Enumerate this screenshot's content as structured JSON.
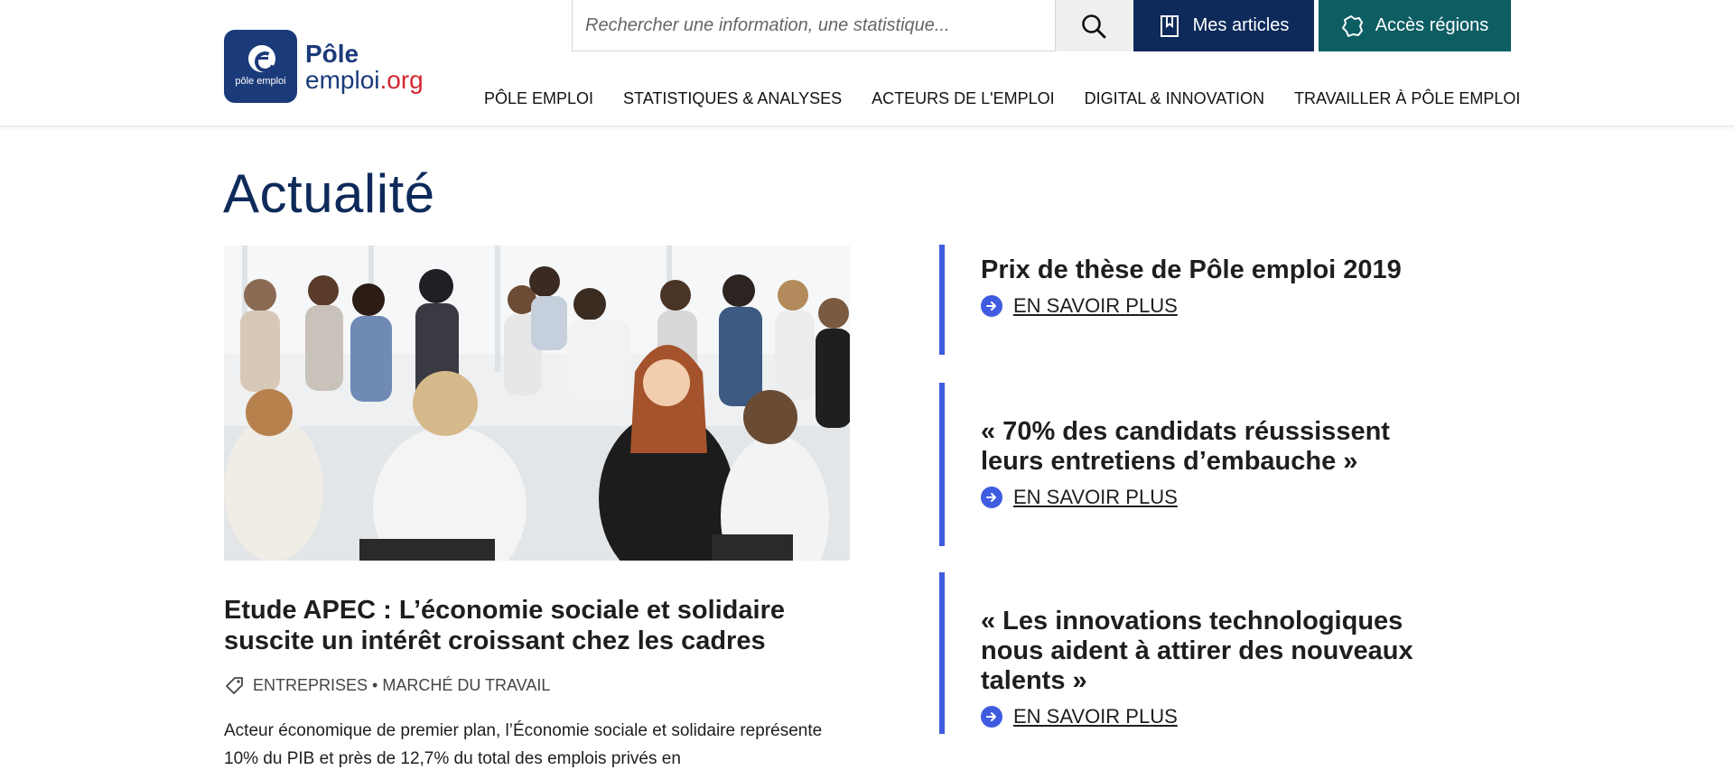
{
  "logo": {
    "badge_text": "pôle emploi",
    "line1": "Pôle",
    "line2_main": "emploi",
    "line2_suffix": ".org",
    "brand_color": "#1b3a7a",
    "suffix_color": "#d22630"
  },
  "search": {
    "placeholder": "Rechercher une information, une statistique..."
  },
  "buttons": {
    "articles": "Mes articles",
    "regions": "Accès régions",
    "articles_color": "#0d2a5a",
    "regions_color": "#0d5e63"
  },
  "nav": {
    "items": [
      "PÔLE EMPLOI",
      "STATISTIQUES & ANALYSES",
      "ACTEURS DE L'EMPLOI",
      "DIGITAL & INNOVATION",
      "TRAVAILLER À PÔLE EMPLOI"
    ]
  },
  "main": {
    "title": "Actualité",
    "hero": {
      "title": "Etude APEC : L’économie sociale et solidaire suscite un intérêt croissant chez les cadres",
      "tags": "ENTREPRISES • MARCHÉ DU TRAVAIL",
      "excerpt": "Acteur économique de premier plan, l’Économie sociale et solidaire représente 10% du PIB et près de 12,7% du total des emplois privés en"
    },
    "cards": [
      {
        "title": "Prix de thèse de Pôle emploi 2019",
        "link": "EN SAVOIR PLUS"
      },
      {
        "title": "« 70% des candidats réussissent leurs entretiens d’embauche »",
        "link": "EN SAVOIR PLUS"
      },
      {
        "title": "« Les innovations technologiques nous aident à attirer des nouveaux talents »",
        "link": "EN SAVOIR PLUS"
      }
    ],
    "accent_color": "#3f5ce0"
  }
}
